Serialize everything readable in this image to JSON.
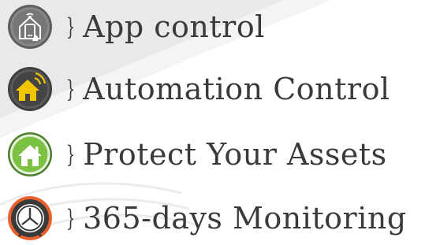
{
  "features": [
    {
      "icon": "smartphone-home-icon",
      "brace": "}",
      "label": "App control"
    },
    {
      "icon": "home-signal-icon",
      "brace": "}",
      "label": "Automation Control"
    },
    {
      "icon": "home-icon",
      "brace": "}",
      "label": "Protect Your Assets"
    },
    {
      "icon": "clock-icon",
      "brace": "}",
      "label": "365-days Monitoring"
    }
  ],
  "colors": {
    "text": "#3a3a3a",
    "icon_gray": "#6f6f6f",
    "icon_yellow": "#f2c500",
    "icon_green": "#7cc242",
    "icon_orange": "#e8612c"
  }
}
